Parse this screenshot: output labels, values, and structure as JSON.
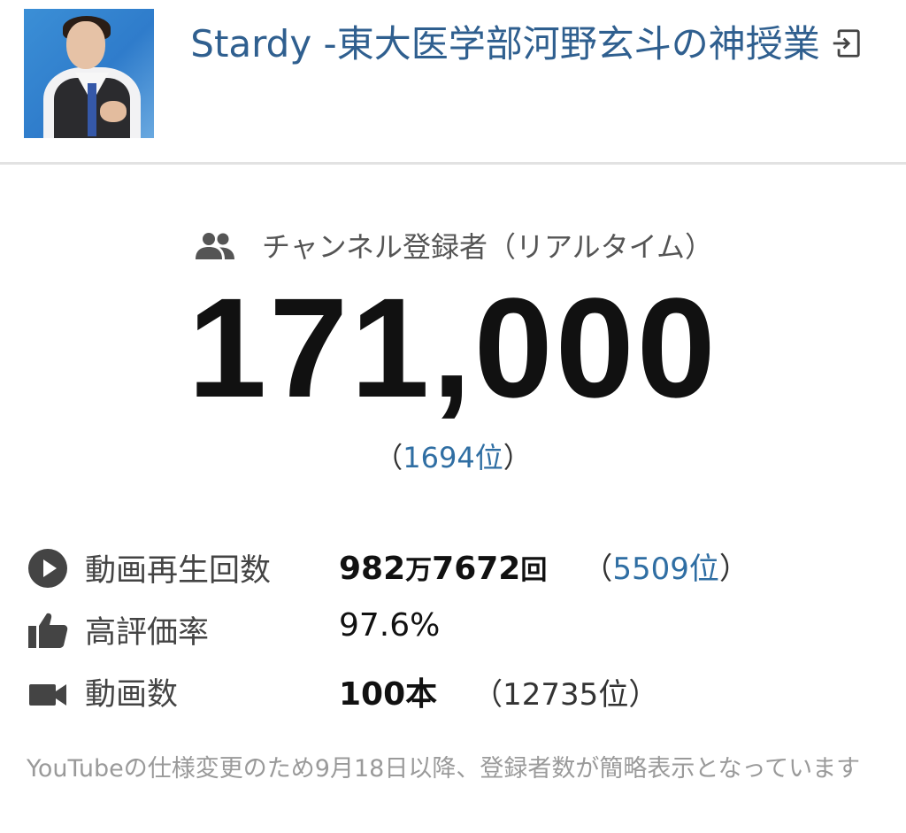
{
  "channel": {
    "title": "Stardy -東大医学部河野玄斗の神授業",
    "exit_icon": "exit-icon"
  },
  "subscribers": {
    "label": "チャンネル登録者（リアルタイム）",
    "icon": "people-icon",
    "count": "171,000",
    "rank_open": "（",
    "rank": "1694位",
    "rank_close": "）"
  },
  "stats": {
    "views": {
      "icon": "play-circle-icon",
      "label": "動画再生回数",
      "num_main": "982",
      "unit_man": "万",
      "num_sub": "7672",
      "unit_kai": "回",
      "rank_open": "（",
      "rank": "5509位",
      "rank_close": "）"
    },
    "rating": {
      "icon": "thumbs-up-icon",
      "label": "高評価率",
      "value": "97.6%"
    },
    "videos": {
      "icon": "video-camera-icon",
      "label": "動画数",
      "value": "100本",
      "rank": "（12735位）"
    }
  },
  "notice": "YouTubeの仕様変更のため9月18日以降、登録者数が簡略表示となっています",
  "colors": {
    "link": "#2f6ea3",
    "title": "#2f5f8f",
    "icon": "#444444",
    "muted": "#9a9a9a"
  }
}
